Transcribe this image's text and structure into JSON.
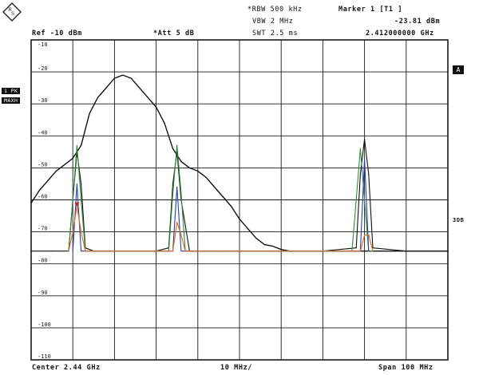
{
  "header": {
    "rbw": "RBW 500 kHz",
    "vbw": "VBW 2 MHz",
    "swt": "SWT 2.5 ms",
    "marker_title": "Marker 1 [T1 ]",
    "marker_level": "-23.81 dBm",
    "marker_freq": "2.412000000 GHz",
    "ref": "Ref -10 dBm",
    "att": "Att  5 dB"
  },
  "side_labels": {
    "trace_mode_1": "1 PK",
    "trace_mode_2": "MAXH",
    "trace_box": "A",
    "threedb": "3DB"
  },
  "footer": {
    "center": "Center  2.44 GHz",
    "div": "10 MHz/",
    "span": "Span  100 MHz"
  },
  "colors": {
    "grid": "#1a1a1a",
    "trace_black": "#111111",
    "trace_green": "#2f8a3a",
    "trace_orange": "#e06a1a",
    "trace_blue": "#2a3fb0",
    "marker": "#d0202a"
  },
  "chart_data": {
    "type": "line",
    "title": "",
    "xlabel": "",
    "ylabel": "",
    "xunit": "GHz",
    "yunit": "dBm",
    "xlim": [
      2.39,
      2.49
    ],
    "ylim": [
      -110,
      -10
    ],
    "y_ticks": [
      -10,
      -20,
      -30,
      -40,
      -50,
      -60,
      -70,
      -80,
      -90,
      -100,
      -110
    ],
    "y_tick_labels": [
      "-10",
      "-20",
      "-30",
      "-40",
      "-50",
      "-60",
      "-70",
      "-80",
      "-90",
      "-100",
      "-110"
    ],
    "grid": true,
    "x_divisions": 10,
    "y_divisions": 10,
    "series": [
      {
        "color": "#111111",
        "x": [
          2.39,
          2.392,
          2.394,
          2.396,
          2.398,
          2.4,
          2.402,
          2.404,
          2.406,
          2.408,
          2.41,
          2.412,
          2.414,
          2.416,
          2.418,
          2.42,
          2.422,
          2.424,
          2.426,
          2.428,
          2.43,
          2.432,
          2.434,
          2.436,
          2.438,
          2.44,
          2.442,
          2.444,
          2.446,
          2.448,
          2.45,
          2.452,
          2.455,
          2.46,
          2.465,
          2.47,
          2.475,
          2.48,
          2.485,
          2.49
        ],
        "y": [
          -61,
          -57,
          -54,
          -51,
          -49,
          -47,
          -43,
          -33,
          -28,
          -25,
          -22,
          -21,
          -22,
          -25,
          -28,
          -31,
          -36,
          -44,
          -48,
          -50,
          -51,
          -53,
          -56,
          -59,
          -62,
          -66,
          -69,
          -72,
          -74,
          -74.5,
          -75.5,
          -76,
          -76,
          -76,
          -76,
          -76,
          -76,
          -76,
          -76,
          -76
        ]
      },
      {
        "color": "#111111",
        "x": [
          2.39,
          2.395,
          2.399,
          2.4,
          2.401,
          2.402,
          2.403,
          2.405,
          2.41,
          2.42,
          2.423,
          2.424,
          2.425,
          2.426,
          2.428,
          2.435,
          2.45,
          2.46,
          2.468,
          2.469,
          2.47,
          2.471,
          2.472,
          2.48,
          2.49
        ],
        "y": [
          -76,
          -76,
          -76,
          -60,
          -45,
          -55,
          -75,
          -76,
          -76,
          -76,
          -75,
          -55,
          -45,
          -60,
          -76,
          -76,
          -76,
          -76,
          -75,
          -52,
          -41,
          -52,
          -75,
          -76,
          -76
        ]
      },
      {
        "color": "#2f8a3a",
        "x": [
          2.399,
          2.4,
          2.401,
          2.402,
          2.403,
          2.404,
          2.423,
          2.424,
          2.425,
          2.426,
          2.427,
          2.467,
          2.468,
          2.469,
          2.47,
          2.471,
          2.472
        ],
        "y": [
          -76,
          -60,
          -43,
          -60,
          -76,
          -76,
          -76,
          -58,
          -43,
          -58,
          -76,
          -76,
          -60,
          -44,
          -60,
          -76,
          -76
        ]
      },
      {
        "color": "#2a3fb0",
        "x": [
          2.4,
          2.401,
          2.402,
          2.424,
          2.425,
          2.426,
          2.469,
          2.47,
          2.471
        ],
        "y": [
          -76,
          -55,
          -76,
          -76,
          -56,
          -76,
          -76,
          -47,
          -76
        ]
      },
      {
        "color": "#e06a1a",
        "x": [
          2.399,
          2.4,
          2.401,
          2.402,
          2.403,
          2.424,
          2.425,
          2.426,
          2.427,
          2.469,
          2.47,
          2.471,
          2.472
        ],
        "y": [
          -76,
          -70,
          -62,
          -70,
          -76,
          -76,
          -67,
          -71,
          -76,
          -76,
          -71,
          -71,
          -76
        ]
      }
    ],
    "marker": {
      "x": 2.401,
      "y": -62
    }
  }
}
